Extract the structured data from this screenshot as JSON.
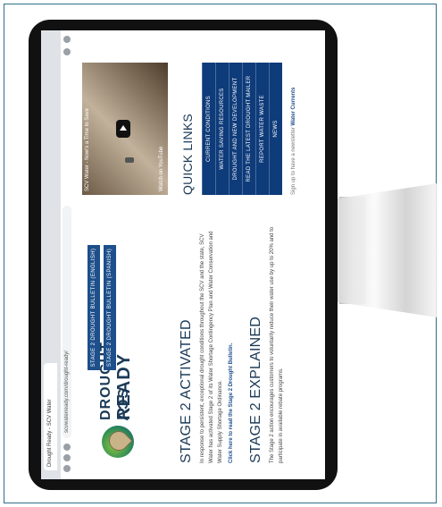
{
  "browser": {
    "tab_title": "Drought Ready - SCV Water",
    "url": "scvwaterready.com/drought-ready/"
  },
  "brand": {
    "line1": "DROUGHT ꓥƆS",
    "line2": "READY"
  },
  "bulletin_buttons": [
    "STAGE 2 DROUGHT BULLETIN (ENGLISH)",
    "STAGE 2 DROUGHT BULLETIN (SPANISH)"
  ],
  "video": {
    "title": "SCV Water - Now's a Time to Save",
    "platform": "Watch on YouTube"
  },
  "sections": {
    "stage2_activated_title": "STAGE 2 ACTIVATED",
    "stage2_activated_text": "In response to persistent, exceptional drought conditions throughout the SCV and the state, SCV Water has activated Stage 2 of its Water Shortage Contingency Plan and Water Conservation and Water Supply Shortage Ordinance.",
    "stage2_activated_link": "Click here to read the Stage 2 Drought Bulletin.",
    "stage2_explained_title": "STAGE 2 EXPLAINED",
    "stage2_explained_text": "The Stage 2 action encourages customers to voluntarily reduce their water use by up to 20% and to participate in available rebate programs."
  },
  "quick_links": {
    "title": "QUICK LINKS",
    "items": [
      "CURRENT CONDITIONS",
      "WATER SAVING RESOURCES",
      "DROUGHT AND NEW DEVELOPMENT",
      "READ THE LATEST DROUGHT MAILER",
      "REPORT WATER WASTE",
      "NEWS"
    ],
    "signup_text": "Sign up to have a newsletter",
    "signup_link": "Water Currents"
  }
}
